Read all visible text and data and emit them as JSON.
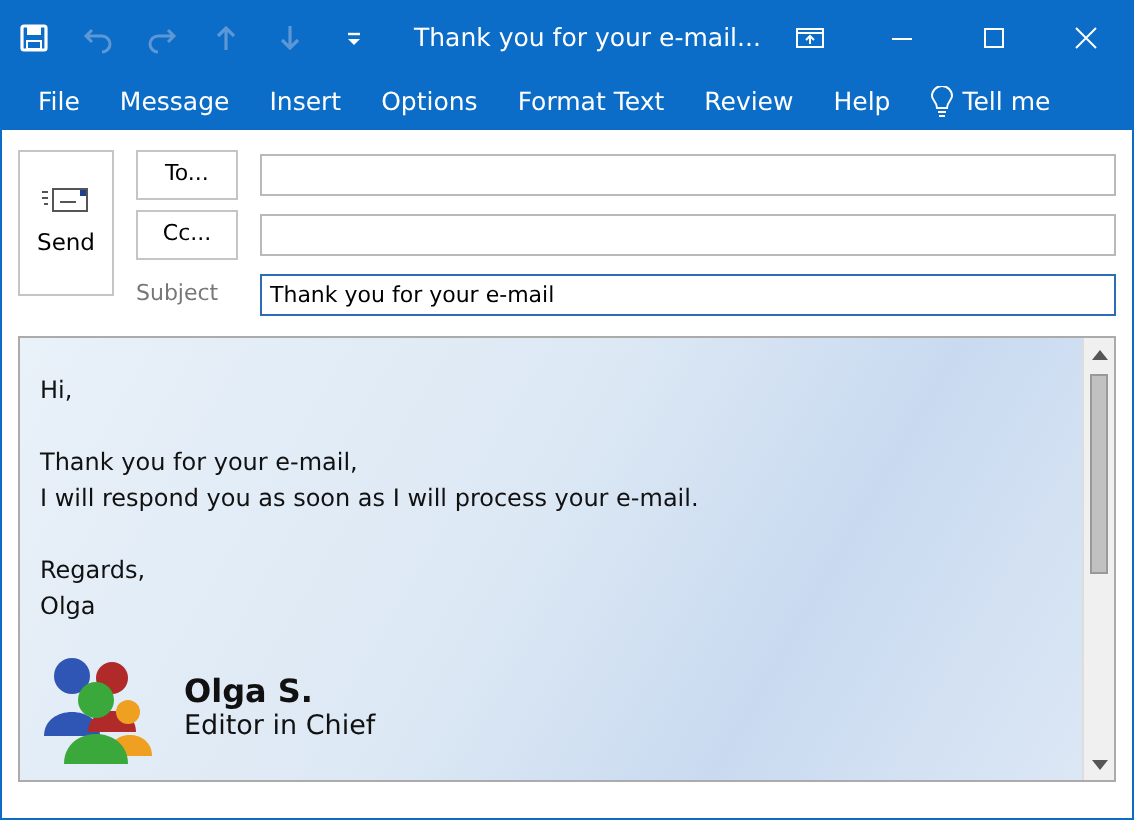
{
  "window": {
    "title": "Thank you for your e-mail..."
  },
  "quick_access": [
    {
      "kind": "save",
      "disabled": false
    },
    {
      "kind": "undo",
      "disabled": true
    },
    {
      "kind": "redo",
      "disabled": true
    },
    {
      "kind": "up",
      "disabled": true
    },
    {
      "kind": "down",
      "disabled": true
    },
    {
      "kind": "customize",
      "disabled": false
    }
  ],
  "ribbon_tabs": [
    {
      "label": "File"
    },
    {
      "label": "Message"
    },
    {
      "label": "Insert"
    },
    {
      "label": "Options"
    },
    {
      "label": "Format Text"
    },
    {
      "label": "Review"
    },
    {
      "label": "Help"
    },
    {
      "label": "Tell me",
      "kind": "search"
    }
  ],
  "compose": {
    "send": "Send",
    "to": {
      "label": "To..."
    },
    "cc": {
      "label": "Cc..."
    },
    "subject": {
      "label": "Subject",
      "value": "Thank you for your e-mail"
    }
  },
  "body": {
    "paragraphs": [
      [
        "Hi,"
      ],
      [
        "Thank you for your e-mail,",
        "I will respond you as soon as I will process your e-mail."
      ],
      [
        "Regards,",
        "Olga"
      ]
    ],
    "signature": {
      "name": "Olga S.",
      "title": "Editor in Chief"
    }
  }
}
